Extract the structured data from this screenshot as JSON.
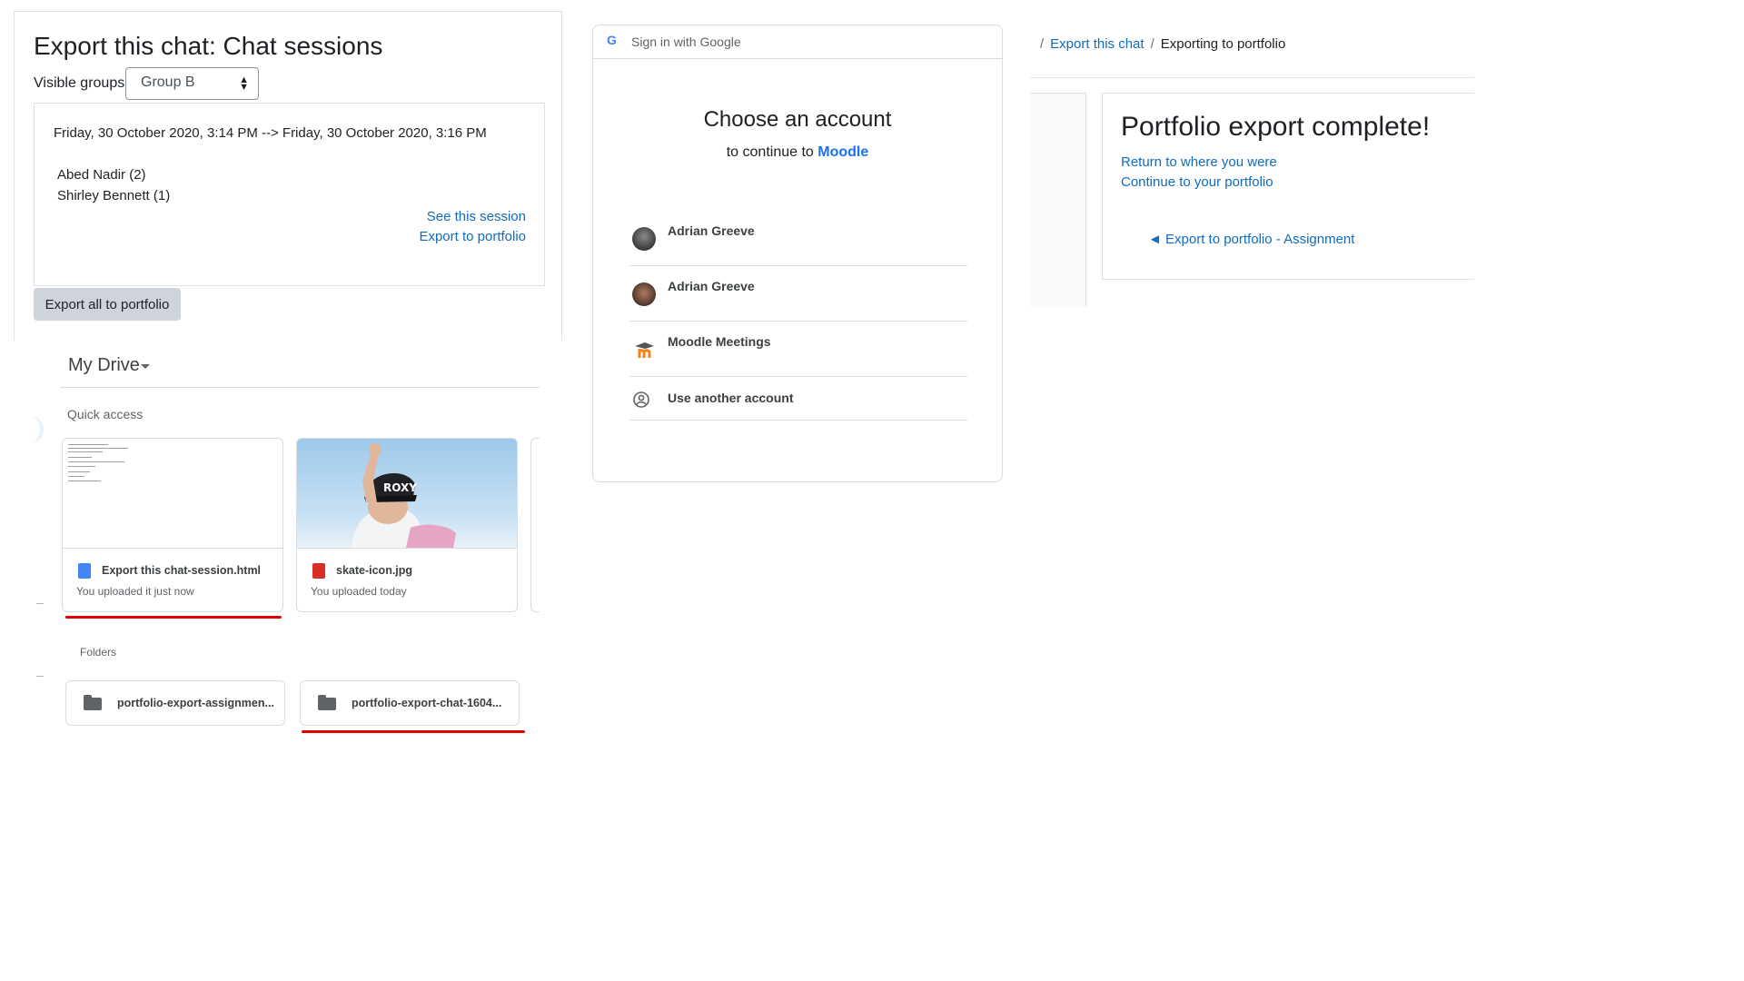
{
  "chat_export": {
    "title": "Export this chat: Chat sessions",
    "visible_groups_label": "Visible groups",
    "visible_groups_value": "Group B",
    "session": {
      "range": "Friday, 30 October 2020, 3:14 PM --> Friday, 30 October 2020, 3:16 PM",
      "users": [
        "Abed Nadir (2)",
        "Shirley Bennett (1)"
      ],
      "see_session_link": "See this session",
      "export_link": "Export to portfolio"
    },
    "export_all_button": "Export all to portfolio"
  },
  "drive": {
    "title": "My Drive",
    "quick_access_label": "Quick access",
    "files": [
      {
        "name": "Export this chat-session.html",
        "meta": "You uploaded it just now",
        "icon": "google-doc-icon",
        "icon_color": "#4285f4"
      },
      {
        "name": "skate-icon.jpg",
        "meta": "You uploaded today",
        "icon": "image-file-icon",
        "icon_color": "#d93025"
      }
    ],
    "folders_label": "Folders",
    "folders": [
      {
        "name": "portfolio-export-assignmen..."
      },
      {
        "name": "portfolio-export-chat-1604..."
      }
    ],
    "highlight_color": "#e00000"
  },
  "google_signin": {
    "header": "Sign in with Google",
    "logo_letter": "G",
    "title": "Choose an account",
    "continue_prefix": "to continue to",
    "continue_brand": "Moodle",
    "accounts": [
      {
        "name": "Adrian Greeve"
      },
      {
        "name": "Adrian Greeve"
      },
      {
        "name": "Moodle Meetings"
      },
      {
        "name": "Use another account"
      }
    ]
  },
  "portfolio": {
    "breadcrumb": {
      "parent": "Export this chat",
      "current": "Exporting to portfolio",
      "separator": "/"
    },
    "title": "Portfolio export complete!",
    "return_link": "Return to where you were",
    "continue_link": "Continue to your portfolio",
    "back_link": "◄ Export to portfolio - Assignment"
  }
}
